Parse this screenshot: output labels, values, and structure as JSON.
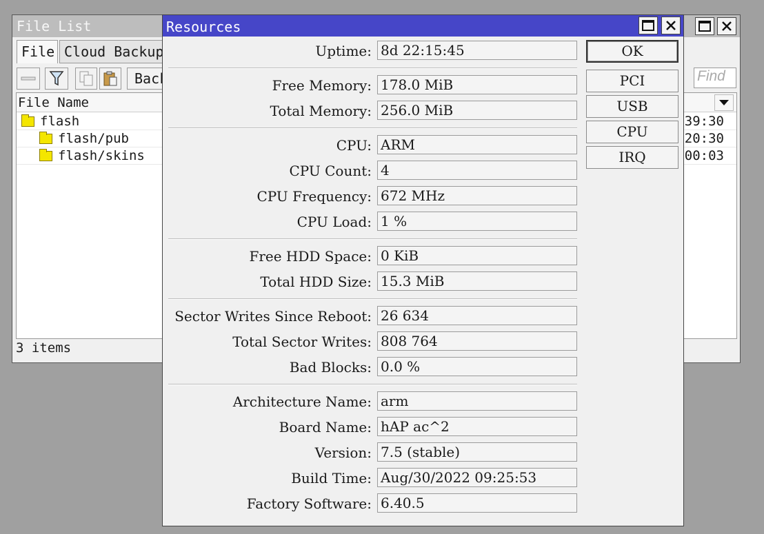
{
  "file_list_window": {
    "title": "File List",
    "tabs": [
      {
        "label": "File"
      },
      {
        "label": "Cloud Backup"
      }
    ],
    "toolbar": {
      "backup_label": "Back",
      "find_placeholder": "Find"
    },
    "columns": {
      "file_name": "File Name"
    },
    "rows": [
      {
        "name": "flash",
        "time": "39:30"
      },
      {
        "name": "flash/pub",
        "time": "20:30"
      },
      {
        "name": "flash/skins",
        "time": "00:03"
      }
    ],
    "status": "3 items"
  },
  "resources_dialog": {
    "title": "Resources",
    "fields": {
      "uptime": {
        "label": "Uptime:",
        "value": "8d 22:15:45"
      },
      "free_memory": {
        "label": "Free Memory:",
        "value": "178.0 MiB"
      },
      "total_memory": {
        "label": "Total Memory:",
        "value": "256.0 MiB"
      },
      "cpu": {
        "label": "CPU:",
        "value": "ARM"
      },
      "cpu_count": {
        "label": "CPU Count:",
        "value": "4"
      },
      "cpu_frequency": {
        "label": "CPU Frequency:",
        "value": "672 MHz"
      },
      "cpu_load": {
        "label": "CPU Load:",
        "value": "1 %"
      },
      "free_hdd": {
        "label": "Free HDD Space:",
        "value": "0 KiB"
      },
      "total_hdd": {
        "label": "Total HDD Size:",
        "value": "15.3 MiB"
      },
      "sector_writes_reboot": {
        "label": "Sector Writes Since Reboot:",
        "value": "26 634"
      },
      "total_sector_writes": {
        "label": "Total Sector Writes:",
        "value": "808 764"
      },
      "bad_blocks": {
        "label": "Bad Blocks:",
        "value": "0.0 %"
      },
      "architecture": {
        "label": "Architecture Name:",
        "value": "arm"
      },
      "board_name": {
        "label": "Board Name:",
        "value": "hAP ac^2"
      },
      "version": {
        "label": "Version:",
        "value": "7.5 (stable)"
      },
      "build_time": {
        "label": "Build Time:",
        "value": "Aug/30/2022 09:25:53"
      },
      "factory_software": {
        "label": "Factory Software:",
        "value": "6.40.5"
      }
    },
    "buttons": {
      "ok": "OK",
      "pci": "PCI",
      "usb": "USB",
      "cpu": "CPU",
      "irq": "IRQ"
    }
  },
  "icons": {
    "maximize": "maximize-icon",
    "close": "close-icon",
    "filter": "filter-icon",
    "copy": "copy-icon",
    "paste": "paste-icon",
    "remove": "remove-icon",
    "folder": "folder-icon",
    "dropdown": "chevron-down-icon"
  },
  "colors": {
    "active_titlebar": "#4646c8",
    "inactive_titlebar": "#bdbdbd",
    "folder": "#f4e600"
  }
}
